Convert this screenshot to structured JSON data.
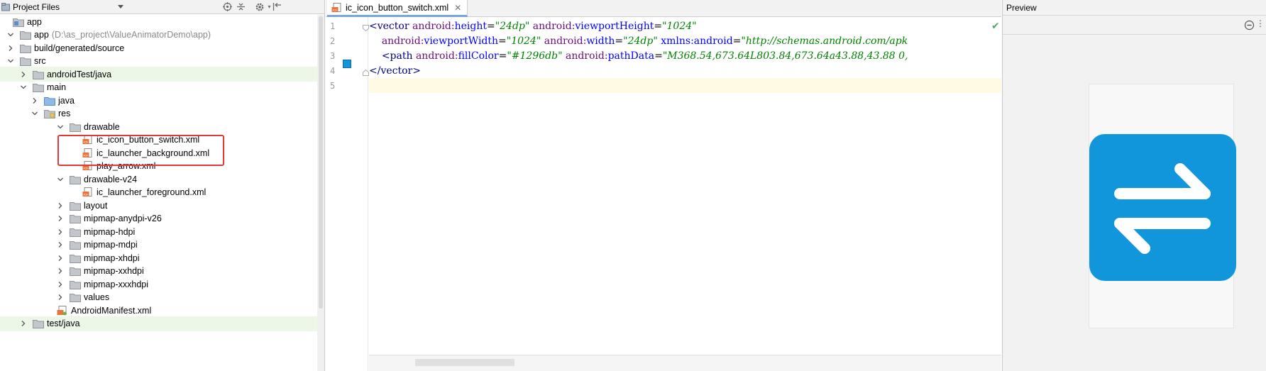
{
  "project_panel": {
    "title": "Project Files",
    "tree": [
      {
        "label": "app",
        "hint": "",
        "icon": "module-root-icon",
        "level": 0,
        "chevron": "none",
        "highlight": false
      },
      {
        "label": "app",
        "hint": "(D:\\as_project\\ValueAnimatorDemo\\app)",
        "icon": "folder-icon",
        "level": 0,
        "chevron": "down",
        "highlight": false
      },
      {
        "label": "build/generated/source",
        "hint": "",
        "icon": "folder-icon",
        "level": 1,
        "chevron": "right",
        "highlight": false
      },
      {
        "label": "src",
        "hint": "",
        "icon": "folder-icon",
        "level": 1,
        "chevron": "down",
        "highlight": false
      },
      {
        "label": "androidTest/java",
        "hint": "",
        "icon": "folder-icon",
        "level": 2,
        "chevron": "right",
        "highlight": true
      },
      {
        "label": "main",
        "hint": "",
        "icon": "folder-icon",
        "level": 2,
        "chevron": "down",
        "highlight": false
      },
      {
        "label": "java",
        "hint": "",
        "icon": "source-folder-icon",
        "level": 3,
        "chevron": "right",
        "highlight": false
      },
      {
        "label": "res",
        "hint": "",
        "icon": "resource-folder-icon",
        "level": 3,
        "chevron": "down",
        "highlight": false
      },
      {
        "label": "drawable",
        "hint": "",
        "icon": "folder-icon",
        "level": 4,
        "chevron": "down",
        "highlight": false
      },
      {
        "label": "ic_icon_button_switch.xml",
        "hint": "",
        "icon": "xml-file-icon",
        "level": 5,
        "chevron": "none",
        "highlight": false
      },
      {
        "label": "ic_launcher_background.xml",
        "hint": "",
        "icon": "xml-file-icon",
        "level": 5,
        "chevron": "none",
        "highlight": false
      },
      {
        "label": "play_arrow.xml",
        "hint": "",
        "icon": "xml-file-icon",
        "level": 5,
        "chevron": "none",
        "highlight": false
      },
      {
        "label": "drawable-v24",
        "hint": "",
        "icon": "folder-icon",
        "level": 4,
        "chevron": "down",
        "highlight": false
      },
      {
        "label": "ic_launcher_foreground.xml",
        "hint": "",
        "icon": "xml-file-icon",
        "level": 5,
        "chevron": "none",
        "highlight": false
      },
      {
        "label": "layout",
        "hint": "",
        "icon": "folder-icon",
        "level": 4,
        "chevron": "right",
        "highlight": false
      },
      {
        "label": "mipmap-anydpi-v26",
        "hint": "",
        "icon": "folder-icon",
        "level": 4,
        "chevron": "right",
        "highlight": false
      },
      {
        "label": "mipmap-hdpi",
        "hint": "",
        "icon": "folder-icon",
        "level": 4,
        "chevron": "right",
        "highlight": false
      },
      {
        "label": "mipmap-mdpi",
        "hint": "",
        "icon": "folder-icon",
        "level": 4,
        "chevron": "right",
        "highlight": false
      },
      {
        "label": "mipmap-xhdpi",
        "hint": "",
        "icon": "folder-icon",
        "level": 4,
        "chevron": "right",
        "highlight": false
      },
      {
        "label": "mipmap-xxhdpi",
        "hint": "",
        "icon": "folder-icon",
        "level": 4,
        "chevron": "right",
        "highlight": false
      },
      {
        "label": "mipmap-xxxhdpi",
        "hint": "",
        "icon": "folder-icon",
        "level": 4,
        "chevron": "right",
        "highlight": false
      },
      {
        "label": "values",
        "hint": "",
        "icon": "folder-icon",
        "level": 4,
        "chevron": "right",
        "highlight": false
      },
      {
        "label": "AndroidManifest.xml",
        "hint": "",
        "icon": "manifest-file-icon",
        "level": 3,
        "chevron": "none",
        "highlight": false
      },
      {
        "label": "test/java",
        "hint": "",
        "icon": "folder-icon",
        "level": 2,
        "chevron": "right",
        "highlight": true
      }
    ]
  },
  "editor": {
    "tab_label": "ic_icon_button_switch.xml",
    "line_numbers": [
      "1",
      "2",
      "3",
      "4",
      "5"
    ],
    "lines": [
      [
        {
          "t": "tag",
          "s": "<vector "
        },
        {
          "t": "ns",
          "s": "android:"
        },
        {
          "t": "attr",
          "s": "height"
        },
        {
          "t": "plain",
          "s": "="
        },
        {
          "t": "val",
          "s": "\"24dp\""
        },
        {
          "t": "plain",
          "s": " "
        },
        {
          "t": "ns",
          "s": "android:"
        },
        {
          "t": "attr",
          "s": "viewportHeight"
        },
        {
          "t": "plain",
          "s": "="
        },
        {
          "t": "val",
          "s": "\"1024\""
        }
      ],
      [
        {
          "t": "plain",
          "s": "    "
        },
        {
          "t": "ns",
          "s": "android:"
        },
        {
          "t": "attr",
          "s": "viewportWidth"
        },
        {
          "t": "plain",
          "s": "="
        },
        {
          "t": "val",
          "s": "\"1024\""
        },
        {
          "t": "plain",
          "s": " "
        },
        {
          "t": "ns",
          "s": "android:"
        },
        {
          "t": "attr",
          "s": "width"
        },
        {
          "t": "plain",
          "s": "="
        },
        {
          "t": "val",
          "s": "\"24dp\""
        },
        {
          "t": "plain",
          "s": " "
        },
        {
          "t": "attr",
          "s": "xmlns:android"
        },
        {
          "t": "plain",
          "s": "="
        },
        {
          "t": "val",
          "s": "\"http://schemas.android.com/apk"
        }
      ],
      [
        {
          "t": "plain",
          "s": "    "
        },
        {
          "t": "tag",
          "s": "<path "
        },
        {
          "t": "ns",
          "s": "android:"
        },
        {
          "t": "attr",
          "s": "fillColor"
        },
        {
          "t": "plain",
          "s": "="
        },
        {
          "t": "val",
          "s": "\"#1296db\""
        },
        {
          "t": "plain",
          "s": " "
        },
        {
          "t": "ns",
          "s": "android:"
        },
        {
          "t": "attr",
          "s": "pathData"
        },
        {
          "t": "plain",
          "s": "="
        },
        {
          "t": "val",
          "s": "\"M368.54,673.64L803.84,673.64a43.88,43.88 0,"
        }
      ],
      [
        {
          "t": "tag",
          "s": "</vector>"
        }
      ],
      []
    ],
    "swatch_color": "#1296db"
  },
  "preview": {
    "title": "Preview",
    "icon_color": "#1296db"
  }
}
